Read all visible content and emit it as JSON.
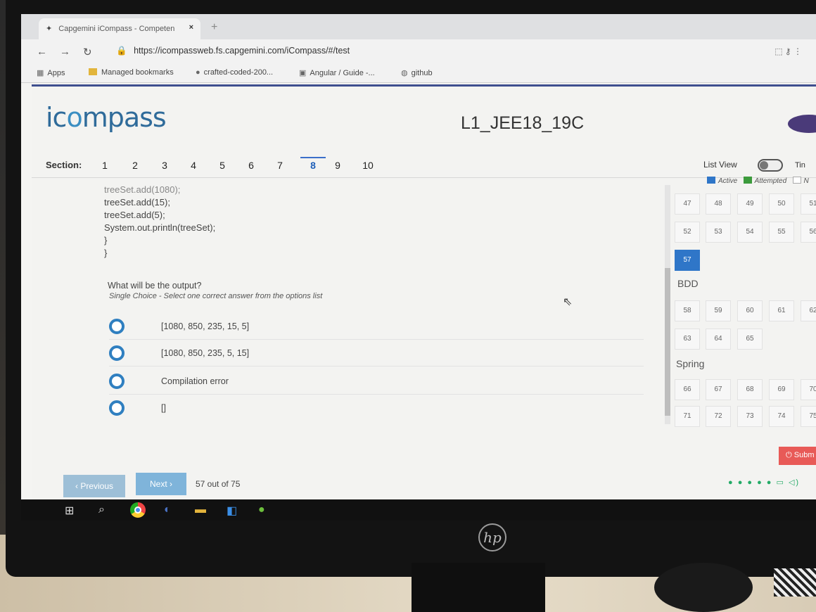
{
  "browser": {
    "tab_title": "Capgemini iCompass - Competen",
    "tab_close": "×",
    "new_tab": "+",
    "url": "https://icompassweb.fs.capgemini.com/iCompass/#/test",
    "bookmarks": [
      "Apps",
      "Managed bookmarks",
      "crafted-coded-200...",
      "Angular / Guide -...",
      "github"
    ]
  },
  "app": {
    "logo_prefix": "ic",
    "logo_o": "o",
    "logo_suffix": "mpass",
    "test_title": "L1_JEE18_19C",
    "section_label": "Section:",
    "sections": [
      "1",
      "2",
      "3",
      "4",
      "5",
      "6",
      "7",
      "8",
      "9",
      "10"
    ],
    "active_section": "8",
    "list_view_label": "List View",
    "timer_label": "Tin"
  },
  "question": {
    "code_lines": [
      "treeSet.add(1080);",
      "treeSet.add(15);",
      "treeSet.add(5);",
      "System.out.println(treeSet);",
      "}",
      "}"
    ],
    "text": "What will be the output?",
    "hint": "Single Choice - Select one correct answer from the options list",
    "options": [
      "[1080, 850, 235, 15, 5]",
      "[1080, 850, 235, 5, 15]",
      "Compilation error",
      "[]"
    ]
  },
  "palette": {
    "legend": [
      "Active",
      "Attempted",
      "N"
    ],
    "colors": {
      "active": "#2f76c8",
      "attempted": "#3c9b3c"
    },
    "row1": [
      "47",
      "48",
      "49",
      "50",
      "51"
    ],
    "row2": [
      "52",
      "53",
      "54",
      "55",
      "56"
    ],
    "row3": [
      "57"
    ],
    "group_bdd": "BDD",
    "row4": [
      "58",
      "59",
      "60",
      "61",
      "62"
    ],
    "row5": [
      "63",
      "64",
      "65"
    ],
    "group_spring": "Spring",
    "row6": [
      "66",
      "67",
      "68",
      "69",
      "70"
    ],
    "row7": [
      "71",
      "72",
      "73",
      "74",
      "75"
    ],
    "submit_label": "Subm"
  },
  "footer": {
    "prev_label": "‹ Previous",
    "next_label": "Next ›",
    "progress_text": "57 out of 75"
  },
  "monitor": {
    "brand": "hp"
  }
}
